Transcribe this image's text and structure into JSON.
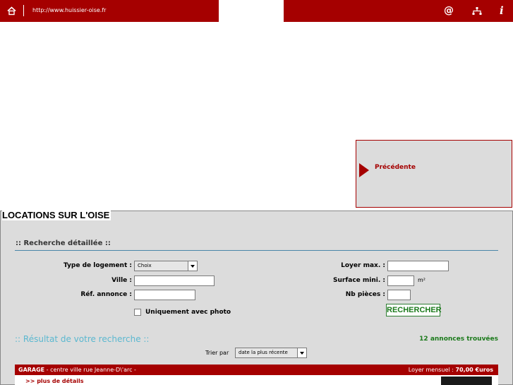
{
  "header": {
    "url": "http://www.huissier-oise.fr",
    "icons": [
      "home-icon",
      "at-icon",
      "sitemap-icon",
      "info-icon"
    ],
    "at_symbol": "@",
    "info_symbol": "i",
    "color": "#a50000"
  },
  "nav": {
    "previous_label": "Précédente"
  },
  "page": {
    "title": "LOCATIONS SUR L'OISE"
  },
  "search": {
    "section_title": ":: Recherche détaillée ::",
    "type_label": "Type de logement :",
    "type_value": "Choix",
    "city_label": "Ville :",
    "ref_label": "Réf. annonce :",
    "rent_label": "Loyer max. :",
    "surface_label": "Surface mini. :",
    "surface_unit": "m²",
    "rooms_label": "Nb pièces :",
    "photo_only_label": "Uniquement avec photo",
    "photo_only_checked": false,
    "submit_label": "RECHERCHER"
  },
  "results": {
    "title": ":: Résultat de votre recherche ::",
    "count_text": "12 annonces trouvées",
    "sort_label": "Trier par",
    "sort_value": "date la plus récente"
  },
  "listing": {
    "type": "GARAGE",
    "location": " - centre ville rue Jeanne-D\\'arc -",
    "rent_label": "Loyer mensuel : ",
    "rent_value": "70,00 €uros",
    "details_link": ">> plus de détails"
  }
}
